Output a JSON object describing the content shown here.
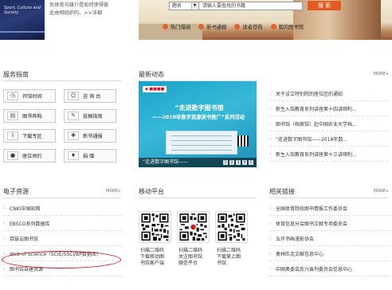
{
  "book": {
    "title": "Sport, Culture and Society"
  },
  "intro": {
    "line1": "及体育与媒介是如何使得彼",
    "line2": "此由相组织的。>>详细"
  },
  "search": {
    "scope": "题名",
    "placeholder": "请输入要查找的书籍",
    "button": "搜 索"
  },
  "quick_links": [
    "热门借阅",
    "新书通报",
    "读者荐购",
    "我的图书馆"
  ],
  "service": {
    "title": "服务指南",
    "buttons": [
      {
        "label": "开馆时间",
        "icon": "clock-icon"
      },
      {
        "label": "咨 询 台",
        "icon": "person-desk-icon"
      },
      {
        "label": "图书荐购",
        "icon": "book-icon"
      },
      {
        "label": "投稿指南",
        "icon": "pen-icon"
      },
      {
        "label": "下载专区",
        "icon": "download-icon"
      },
      {
        "label": "新书通报",
        "icon": "new-book-icon"
      },
      {
        "label": "座位预约",
        "icon": "seat-icon"
      },
      {
        "label": "捐 赠",
        "icon": "gift-icon"
      }
    ]
  },
  "news": {
    "title": "最新动态",
    "more": "MORE+",
    "photo": {
      "headline1": "“走进数字图书馆",
      "headline2": "——2018年数字资源读书推广”系列活动",
      "caption": "“走进数字图书馆——",
      "dots": [
        "1",
        "2",
        "3",
        "4",
        "5"
      ]
    },
    "items": [
      "关于设立特别院的座位区的通知",
      "新生入馆教育系列讲座第十四讲顺利...",
      "图书馆（档案馆）赴中国农业大学档...",
      "“走进数字图书馆——2018年数...",
      "新生入馆教育系列讲座第十三讲顺利..."
    ]
  },
  "eres": {
    "title": "电子资源",
    "more": "MORE+",
    "items": [
      "CNKI中国知网",
      "EBSCO系列数据库",
      "百链云图书馆",
      "Web of Science（SCIE/SSCI/BP数据库）",
      "图书馆自建资源"
    ]
  },
  "mobile": {
    "title": "移动平台",
    "codes": [
      {
        "line1": "扫描二维码",
        "line2": "下载移动图",
        "line3": "书馆客户端"
      },
      {
        "line1": "扫描二维码",
        "line2": "关注图书馆",
        "line3": "微信平台"
      },
      {
        "line1": "扫描二维码",
        "line2": "下载掌上图",
        "line3": "书馆"
      }
    ]
  },
  "links": {
    "title": "相关链接",
    "more": "MORE+",
    "items": [
      "全国体育院校图书情报工作委员会",
      "体育信息分会图书文献专项委员会",
      "五环书画漫影协会",
      "奥林匹克文献信息中心",
      "中国奥委会反兴奋剂委员会信息中心"
    ]
  },
  "colors": {
    "accent": "#e15b22",
    "highlight_circle": "#d41818"
  }
}
